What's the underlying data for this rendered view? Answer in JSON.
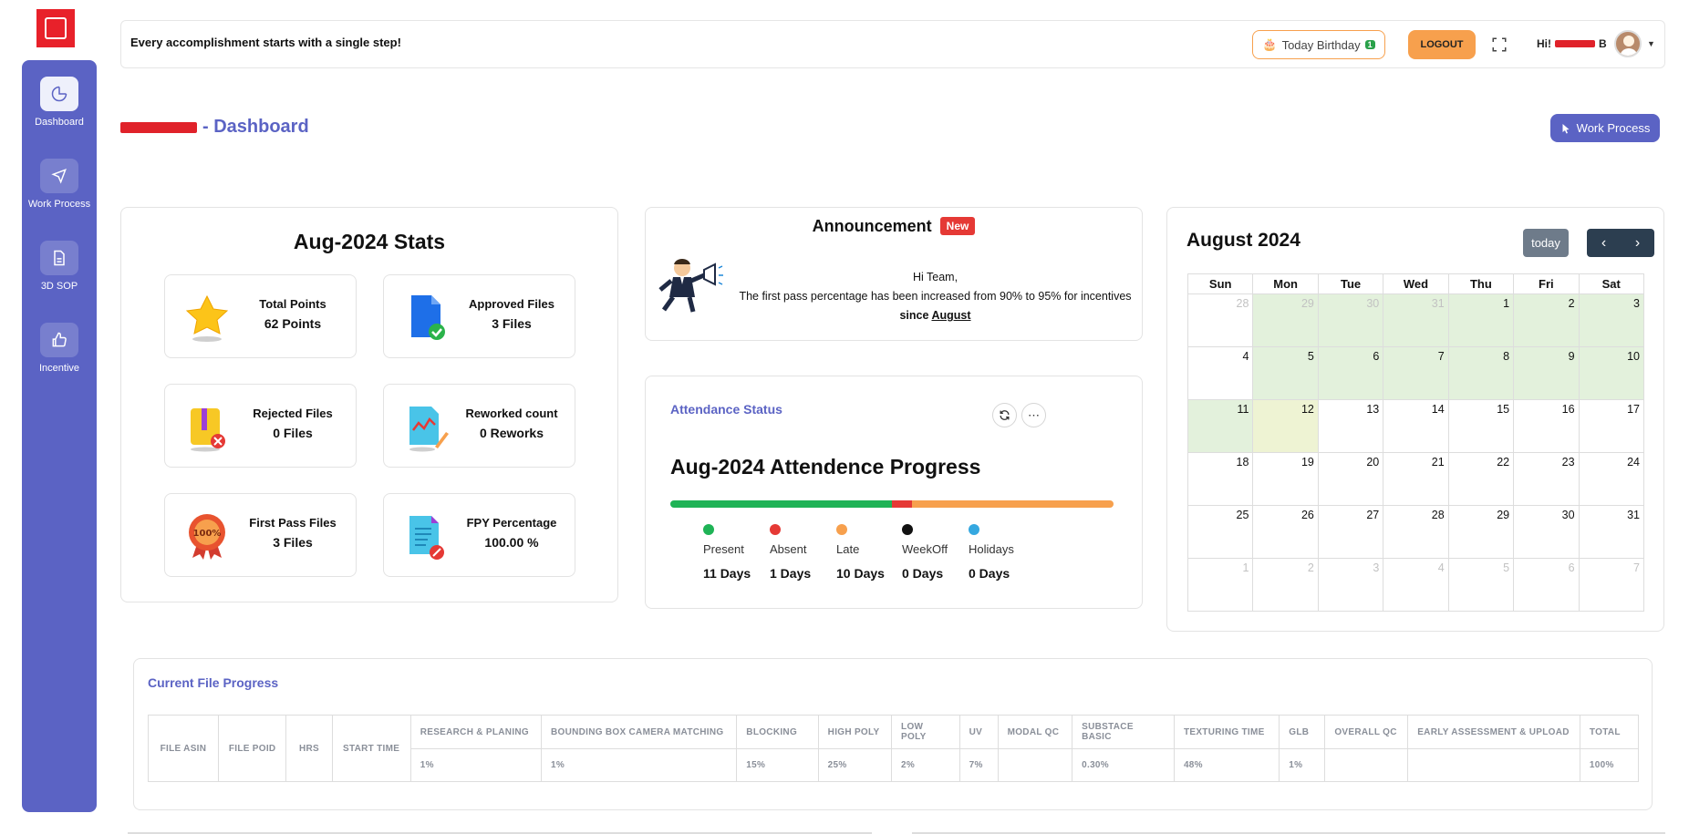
{
  "topbar": {
    "quote": "Every accomplishment starts with a single step!",
    "birthday_label": "Today Birthday",
    "birthday_count": "1",
    "logout_label": "LOGOUT",
    "greeting_prefix": "Hi!",
    "greeting_suffix": "B"
  },
  "sidebar": {
    "items": [
      {
        "label": "Dashboard",
        "icon": "pie-chart-icon",
        "active": true
      },
      {
        "label": "Work Process",
        "icon": "cursor-icon",
        "active": false
      },
      {
        "label": "3D SOP",
        "icon": "file-icon",
        "active": false
      },
      {
        "label": "Incentive",
        "icon": "thumbs-up-icon",
        "active": false
      }
    ]
  },
  "page": {
    "title_suffix": "- Dashboard",
    "work_process_button": "Work Process"
  },
  "stats": {
    "title": "Aug-2024 Stats",
    "items": [
      {
        "label": "Total Points",
        "value": "62 Points",
        "icon": "star-icon"
      },
      {
        "label": "Approved Files",
        "value": "3 Files",
        "icon": "approved-file-icon"
      },
      {
        "label": "Rejected Files",
        "value": "0 Files",
        "icon": "rejected-file-icon"
      },
      {
        "label": "Reworked count",
        "value": "0 Reworks",
        "icon": "rework-file-icon"
      },
      {
        "label": "First Pass Files",
        "value": "3 Files",
        "icon": "badge-100-icon"
      },
      {
        "label": "FPY Percentage",
        "value": "100.00 %",
        "icon": "percentage-file-icon"
      }
    ]
  },
  "announcement": {
    "title": "Announcement",
    "badge": "New",
    "line1": "Hi Team,",
    "line2": "The first pass percentage has been increased from 90% to 95% for incentives",
    "line3_prefix": "since",
    "line3_link": "August"
  },
  "attendance": {
    "header": "Attendance Status",
    "title": "Aug-2024 Attendence Progress",
    "refresh_icon": "refresh-icon",
    "more_icon": "more-horizontal-icon",
    "progress": [
      {
        "label": "Present",
        "days": 11,
        "color": "#1fb356"
      },
      {
        "label": "Absent",
        "days": 1,
        "color": "#e53935"
      },
      {
        "label": "Late",
        "days": 10,
        "color": "#f7a04d"
      },
      {
        "label": "WeekOff",
        "days": 0,
        "color": "#111111"
      },
      {
        "label": "Holidays",
        "days": 0,
        "color": "#35a8e0"
      }
    ],
    "values": [
      "11 Days",
      "1 Days",
      "10 Days",
      "0 Days",
      "0 Days"
    ]
  },
  "calendar": {
    "title": "August 2024",
    "today_label": "today",
    "weekdays": [
      "Sun",
      "Mon",
      "Tue",
      "Wed",
      "Thu",
      "Fri",
      "Sat"
    ],
    "weeks": [
      [
        "28",
        "29",
        "30",
        "31",
        "1",
        "2",
        "3"
      ],
      [
        "4",
        "5",
        "6",
        "7",
        "8",
        "9",
        "10"
      ],
      [
        "11",
        "12",
        "13",
        "14",
        "15",
        "16",
        "17"
      ],
      [
        "18",
        "19",
        "20",
        "21",
        "22",
        "23",
        "24"
      ],
      [
        "25",
        "26",
        "27",
        "28",
        "29",
        "30",
        "31"
      ],
      [
        "1",
        "2",
        "3",
        "4",
        "5",
        "6",
        "7"
      ]
    ]
  },
  "file_progress": {
    "title": "Current File Progress",
    "fixed_headers": [
      "FILE ASIN",
      "FILE POID",
      "HRS",
      "START TIME"
    ],
    "stage_headers": [
      "RESEARCH & PLANING",
      "BOUNDING BOX CAMERA MATCHING",
      "BLOCKING",
      "HIGH POLY",
      "LOW POLY",
      "UV",
      "MODAL QC",
      "SUBSTACE BASIC",
      "TEXTURING TIME",
      "GLB",
      "OVERALL QC",
      "EARLY ASSESSMENT & UPLOAD",
      "TOTAL"
    ],
    "stage_values": [
      "1%",
      "1%",
      "15%",
      "25%",
      "2%",
      "7%",
      "",
      "0.30%",
      "48%",
      "1%",
      "",
      "",
      "100%"
    ]
  }
}
